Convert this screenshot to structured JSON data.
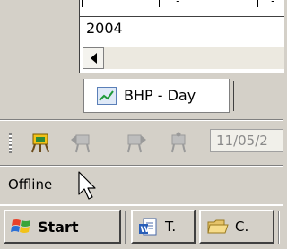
{
  "chart": {
    "tick_fragments": [
      "'",
      "' - ''",
      "' -"
    ],
    "year_label": "2004"
  },
  "tab": {
    "label": "BHP - Day"
  },
  "toolbar": {
    "date_value": "11/05/2",
    "icons": [
      "chart-tool-icon",
      "back-icon",
      "forward-icon",
      "pin-icon"
    ]
  },
  "status": {
    "text": "Offline"
  },
  "taskbar": {
    "start_label": "Start",
    "tasks": [
      {
        "label": "T.",
        "icon": "word-document-icon"
      },
      {
        "label": "C.",
        "icon": "folder-icon"
      }
    ]
  },
  "colors": {
    "face": "#d4d0c8",
    "active_icon": "#2e8b3a",
    "disabled_icon": "#9a9a9a"
  }
}
